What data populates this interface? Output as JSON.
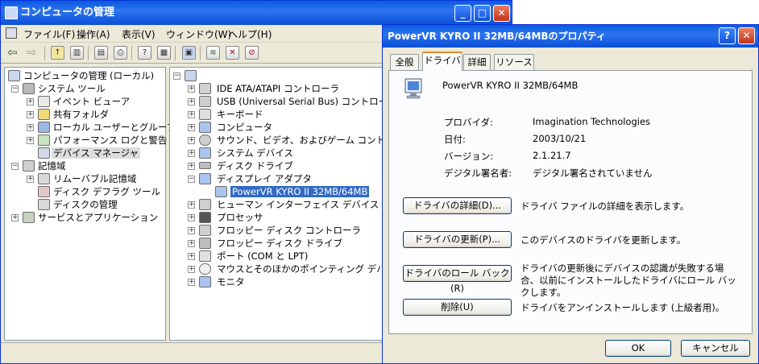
{
  "main_window": {
    "title": "コンピュータの管理",
    "controls": {
      "minimize": "_",
      "maximize": "□",
      "close": "✕"
    },
    "menu": [
      "ファイル(F)",
      "操作(A)",
      "表示(V)",
      "ウィンドウ(W)",
      "ヘルプ(H)"
    ],
    "toolbar_icons": [
      "back-icon",
      "forward-icon",
      "up-folder-icon",
      "show-tree-icon",
      "properties-icon",
      "print-icon",
      "help-icon",
      "console-icon",
      "scan-hardware-icon",
      "update-driver-icon",
      "uninstall-icon",
      "disable-icon"
    ]
  },
  "left_tree": {
    "root": "コンピュータの管理 (ローカル)",
    "items": [
      {
        "label": "システム ツール",
        "level": 1,
        "expander": "−"
      },
      {
        "label": "イベント ビューア",
        "level": 2,
        "expander": "+"
      },
      {
        "label": "共有フォルダ",
        "level": 2,
        "expander": "+"
      },
      {
        "label": "ローカル ユーザーとグループ",
        "level": 2,
        "expander": "+"
      },
      {
        "label": "パフォーマンス ログと警告",
        "level": 2,
        "expander": "+"
      },
      {
        "label": "デバイス マネージャ",
        "level": 2,
        "expander": ""
      },
      {
        "label": "記憶域",
        "level": 1,
        "expander": "−"
      },
      {
        "label": "リムーバブル記憶域",
        "level": 2,
        "expander": "+"
      },
      {
        "label": "ディスク デフラグ ツール",
        "level": 2,
        "expander": ""
      },
      {
        "label": "ディスクの管理",
        "level": 2,
        "expander": ""
      },
      {
        "label": "サービスとアプリケーション",
        "level": 1,
        "expander": "+"
      }
    ]
  },
  "device_tree": {
    "root": "",
    "items": [
      {
        "label": "IDE ATA/ATAPI コントローラ",
        "expander": "+"
      },
      {
        "label": "USB (Universal Serial Bus) コントローラ",
        "expander": "+"
      },
      {
        "label": "キーボード",
        "expander": "+"
      },
      {
        "label": "コンピュータ",
        "expander": "+"
      },
      {
        "label": "サウンド、ビデオ、およびゲーム コントローラ",
        "expander": "+"
      },
      {
        "label": "システム デバイス",
        "expander": "+"
      },
      {
        "label": "ディスク ドライブ",
        "expander": "+"
      },
      {
        "label": "ディスプレイ アダプタ",
        "expander": "−"
      },
      {
        "label": "PowerVR KYRO II 32MB/64MB",
        "expander": "",
        "child": true
      },
      {
        "label": "ヒューマン インターフェイス デバイス",
        "expander": "+"
      },
      {
        "label": "プロセッサ",
        "expander": "+"
      },
      {
        "label": "フロッピー ディスク コントローラ",
        "expander": "+"
      },
      {
        "label": "フロッピー ディスク ドライブ",
        "expander": "+"
      },
      {
        "label": "ポート (COM と LPT)",
        "expander": "+"
      },
      {
        "label": "マウスとそのほかのポインティング デバイス",
        "expander": "+"
      },
      {
        "label": "モニタ",
        "expander": "+"
      }
    ]
  },
  "dialog": {
    "title": "PowerVR KYRO II 32MB/64MBのプロパティ",
    "controls": {
      "help": "?",
      "close": "✕"
    },
    "tabs": [
      "全般",
      "ドライバ",
      "詳細",
      "リソース"
    ],
    "device_name": "PowerVR KYRO II 32MB/64MB",
    "info": [
      {
        "label": "プロバイダ:",
        "value": "Imagination Technologies"
      },
      {
        "label": "日付:",
        "value": "2003/10/21"
      },
      {
        "label": "バージョン:",
        "value": "2.1.21.7"
      },
      {
        "label": "デジタル署名者:",
        "value": "デジタル署名されていません"
      }
    ],
    "actions": [
      {
        "button": "ドライバの詳細(D)...",
        "desc": "ドライバ ファイルの詳細を表示します。"
      },
      {
        "button": "ドライバの更新(P)...",
        "desc": "このデバイスのドライバを更新します。"
      },
      {
        "button": "ドライバのロール バック(R)",
        "desc": "ドライバの更新後にデバイスの認識が失敗する場合、以前にインストールしたドライバにロール バックします。"
      },
      {
        "button": "削除(U)",
        "desc": "ドライバをアンインストールします (上級者用)。"
      }
    ],
    "ok": "OK",
    "cancel": "キャンセル"
  }
}
